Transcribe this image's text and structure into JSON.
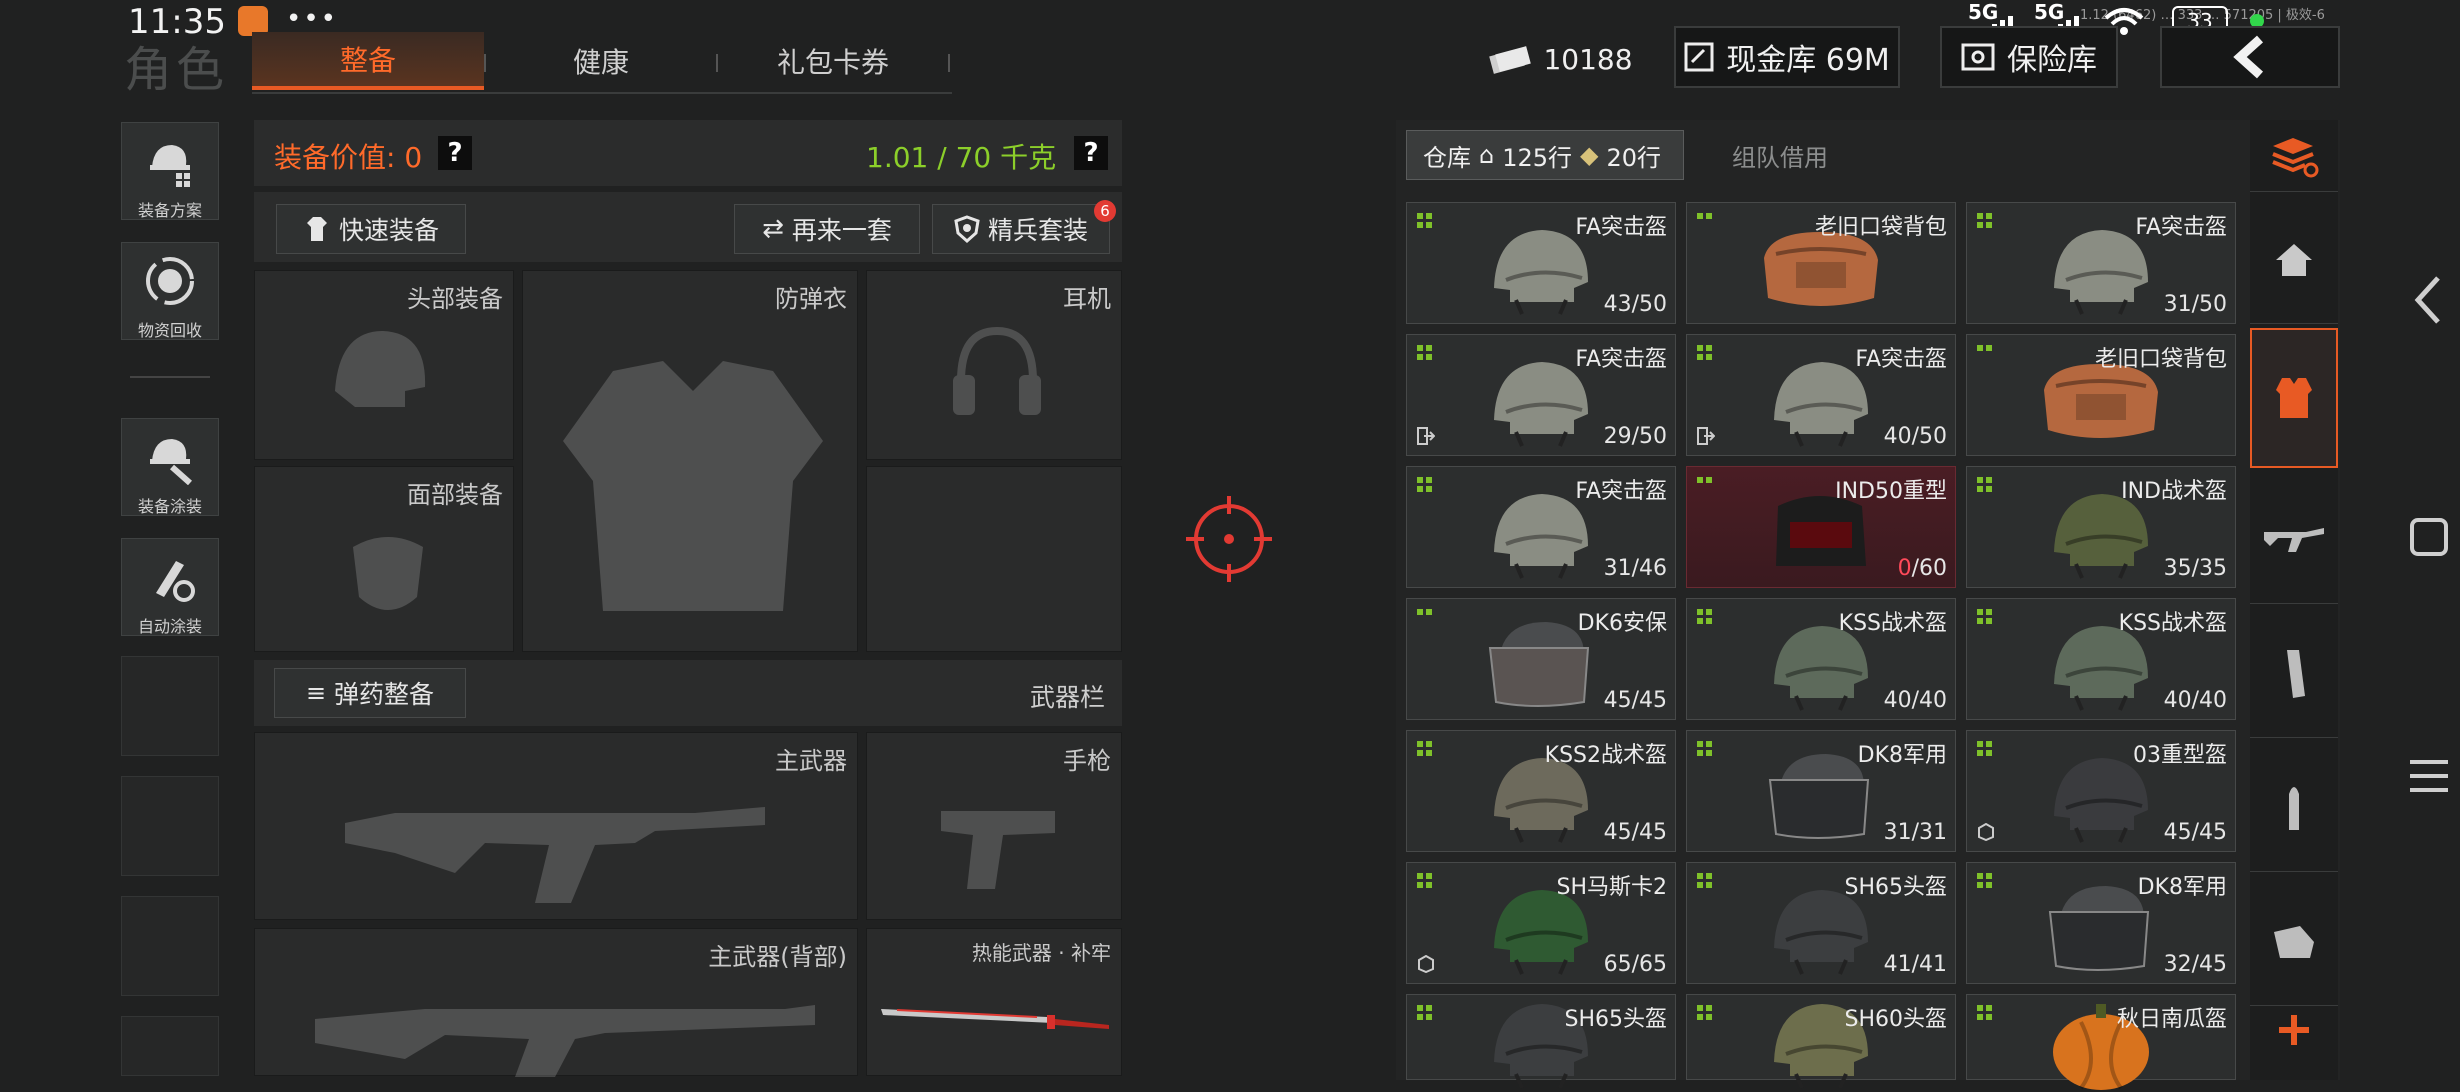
{
  "status_bar": {
    "time": "11:35",
    "dots": "•••",
    "signal1": "5G",
    "signal2": "5G",
    "battery": "33",
    "tiny_text": "1.12 (6462) … 333 … 571205 | 极效-6"
  },
  "header": {
    "ghost_title": "角色",
    "tabs": [
      {
        "label": "整备",
        "active": true
      },
      {
        "label": "健康",
        "active": false
      },
      {
        "label": "礼包卡券",
        "active": false
      }
    ],
    "money": "10188",
    "cash_vault": "现金库 69M",
    "insurance": "保险库"
  },
  "left_nav": [
    {
      "label": "装备方案",
      "icon": "loadout-plan-icon"
    },
    {
      "label": "物资回收",
      "icon": "recycle-icon"
    },
    {
      "label": "装备涂装",
      "icon": "paint-icon"
    },
    {
      "label": "自动涂装",
      "icon": "auto-paint-icon"
    }
  ],
  "equip": {
    "value_label": "装备价值: 0",
    "weight": "1.01 / 70 千克",
    "help": "?",
    "quick_equip": "快速装备",
    "again": "再来一套",
    "elite_set": "精兵套装",
    "elite_badge": "6",
    "slots": {
      "head": "头部装备",
      "armor": "防弹衣",
      "headset": "耳机",
      "face": "面部装备"
    },
    "ammo_btn": "弹药整备",
    "weapon_bar": "武器栏",
    "primary": "主武器",
    "pistol": "手枪",
    "primary_back": "主武器(背部)",
    "melee": "热能武器 · 补牢"
  },
  "warehouse": {
    "tab_label": "仓库",
    "rows_house": "125行",
    "rows_tag": "20行",
    "team_borrow": "组队借用",
    "items": [
      {
        "name": "FA突击盔",
        "dur": "43/50",
        "art": "helmet",
        "color": "#8a8d83",
        "icon": ""
      },
      {
        "name": "老旧口袋背包",
        "dur": "",
        "art": "bag",
        "color": "#b5683f",
        "icon": ""
      },
      {
        "name": "FA突击盔",
        "dur": "31/50",
        "art": "helmet",
        "color": "#8a8d83",
        "icon": ""
      },
      {
        "name": "FA突击盔",
        "dur": "29/50",
        "art": "helmet",
        "color": "#8a8d83",
        "icon": "exit"
      },
      {
        "name": "FA突击盔",
        "dur": "40/50",
        "art": "helmet",
        "color": "#8a8d83",
        "icon": "exit"
      },
      {
        "name": "老旧口袋背包",
        "dur": "",
        "art": "bag",
        "color": "#b5683f",
        "icon": ""
      },
      {
        "name": "FA突击盔",
        "dur": "31/46",
        "art": "helmet",
        "color": "#8a8d83",
        "icon": ""
      },
      {
        "name": "IND50重型",
        "dur": "60",
        "dur_red": "0",
        "art": "heavy",
        "color": "#1c1c1c",
        "icon": "",
        "highlight": true
      },
      {
        "name": "IND战术盔",
        "dur": "35/35",
        "art": "helmet",
        "color": "#56603c",
        "icon": ""
      },
      {
        "name": "DK6安保",
        "dur": "45/45",
        "art": "visor",
        "color": "#5a5452",
        "icon": ""
      },
      {
        "name": "KSS战术盔",
        "dur": "40/40",
        "art": "helmet",
        "color": "#5d6a5b",
        "icon": ""
      },
      {
        "name": "KSS战术盔",
        "dur": "40/40",
        "art": "helmet",
        "color": "#5d6a5b",
        "icon": ""
      },
      {
        "name": "KSS2战术盔",
        "dur": "45/45",
        "art": "helmet",
        "color": "#6d6a5c",
        "icon": ""
      },
      {
        "name": "DK8军用",
        "dur": "31/31",
        "art": "visor",
        "color": "#2a2c2e",
        "icon": ""
      },
      {
        "name": "03重型盔",
        "dur": "45/45",
        "art": "helmet",
        "color": "#3a3b3e",
        "icon": "box"
      },
      {
        "name": "SH马斯卡2",
        "dur": "65/65",
        "art": "helmet",
        "color": "#2f5a32",
        "icon": "box"
      },
      {
        "name": "SH65头盔",
        "dur": "41/41",
        "art": "helmet",
        "color": "#3c3e40",
        "icon": ""
      },
      {
        "name": "DK8军用",
        "dur": "32/45",
        "art": "visor",
        "color": "#2a2c2e",
        "icon": ""
      },
      {
        "name": "SH65头盔",
        "dur": "",
        "art": "helmet",
        "color": "#3c3e40",
        "icon": ""
      },
      {
        "name": "SH60头盔",
        "dur": "",
        "art": "helmet",
        "color": "#6d6e4c",
        "icon": ""
      },
      {
        "name": "秋日南瓜盔",
        "dur": "",
        "art": "pumpkin",
        "color": "#d8731e",
        "icon": ""
      }
    ]
  },
  "right_tabs": [
    "sort-icon",
    "home-icon",
    "armor-icon",
    "rifle-icon",
    "magazine-icon",
    "ammo-icon",
    "gear-icon",
    "add-icon"
  ],
  "colors": {
    "accent": "#e85a24",
    "green": "#7fc12a",
    "red": "#e23a33"
  }
}
